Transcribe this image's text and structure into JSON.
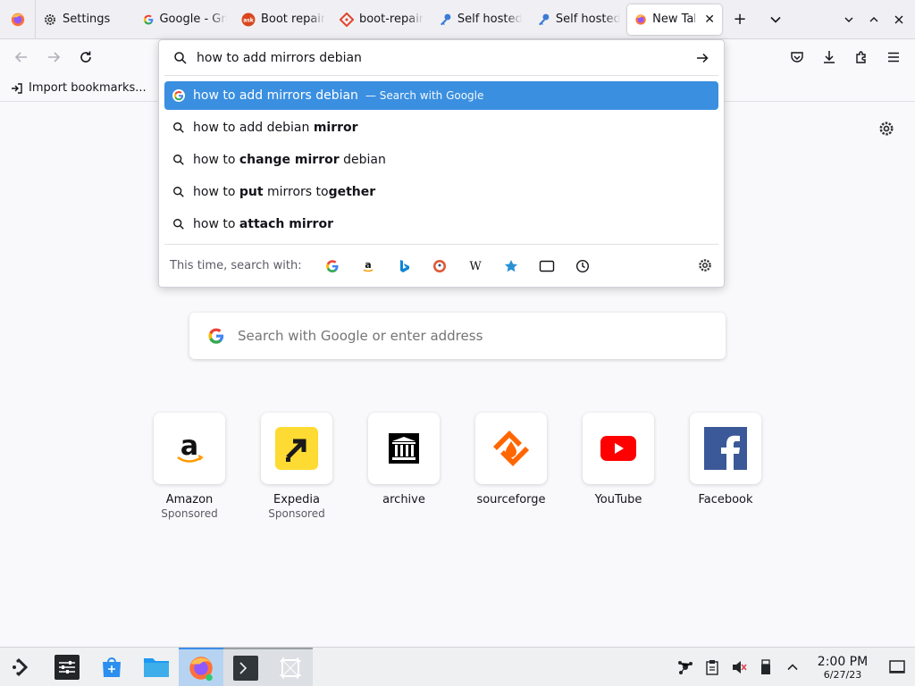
{
  "tabs": [
    {
      "label": "Settings",
      "icon": "gear-icon"
    },
    {
      "label": "Google - Gmail",
      "icon": "google-icon"
    },
    {
      "label": "Boot repair",
      "icon": "ask-icon"
    },
    {
      "label": "boot-repair",
      "icon": "git-icon"
    },
    {
      "label": "Self hosted",
      "icon": "key-icon"
    },
    {
      "label": "Self hosted",
      "icon": "key-icon"
    },
    {
      "label": "New Tab",
      "icon": "firefox-icon"
    }
  ],
  "bookmarks": {
    "import_label": "Import bookmarks..."
  },
  "urlbar": {
    "value": "how to add mirrors debian",
    "suggestions": [
      {
        "pre": "how to add mirrors debian",
        "bold": "",
        "post": "",
        "meta": "— Search with Google"
      },
      {
        "pre": "how to add debian ",
        "bold": "mirror",
        "post": ""
      },
      {
        "pre": "how to ",
        "bold": "change mirror",
        "post": " debian"
      },
      {
        "pre": "how to ",
        "bold": "put",
        "post": " mirrors to",
        "bold2": "gether"
      },
      {
        "pre": "how to ",
        "bold": "attach mirror",
        "post": ""
      }
    ],
    "search_with_label": "This time, search with:"
  },
  "newtab": {
    "search_placeholder": "Search with Google or enter address",
    "tiles": [
      {
        "title": "Amazon",
        "sub": "Sponsored"
      },
      {
        "title": "Expedia",
        "sub": "Sponsored"
      },
      {
        "title": "archive",
        "sub": ""
      },
      {
        "title": "sourceforge",
        "sub": ""
      },
      {
        "title": "YouTube",
        "sub": ""
      },
      {
        "title": "Facebook",
        "sub": ""
      }
    ]
  },
  "taskbar": {
    "time": "2:00 PM",
    "date": "6/27/23"
  },
  "colors": {
    "accent": "#3a8fe0",
    "youtube": "#ff0000",
    "facebook": "#3b5998",
    "expedia": "#fddb32",
    "sourceforge": "#ff6600"
  }
}
